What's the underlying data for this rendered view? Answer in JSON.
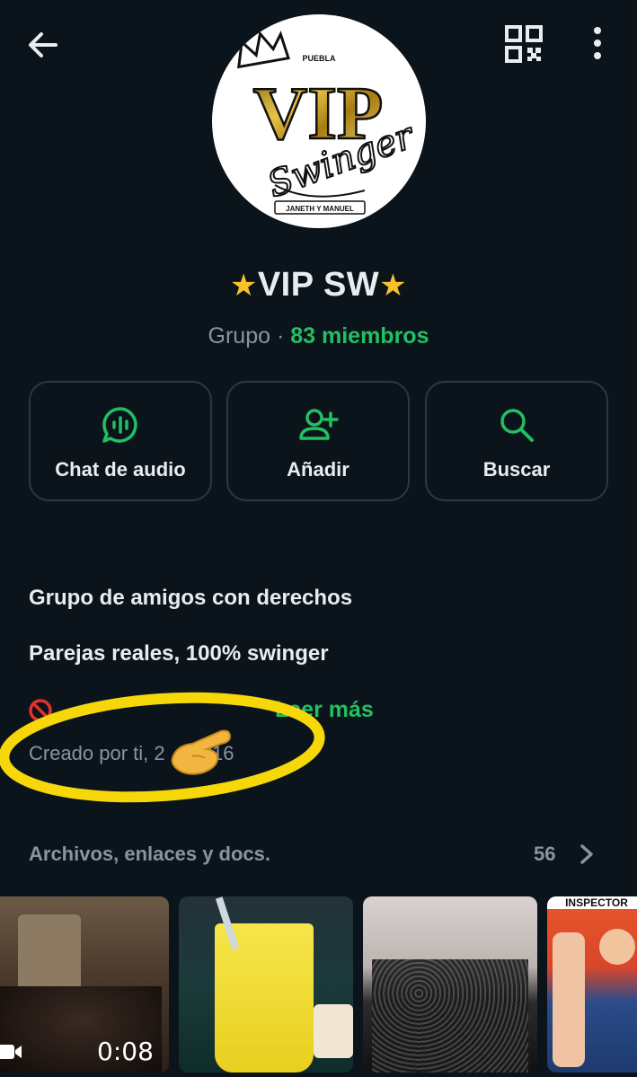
{
  "header": {
    "back_icon": "arrow-left-icon",
    "qr_icon": "qr-code-icon",
    "more_icon": "more-vertical-icon"
  },
  "avatar": {
    "top_text": "PUEBLA",
    "main_text": "VIP",
    "script_text": "Swinger",
    "bottom_text": "JANETH Y MANUEL"
  },
  "group": {
    "name": "VIP SW",
    "type_label": "Grupo",
    "separator": "·",
    "members_label": "83 miembros"
  },
  "actions": [
    {
      "label": "Chat de audio",
      "icon": "audio-chat-icon"
    },
    {
      "label": "Añadir",
      "icon": "add-person-icon"
    },
    {
      "label": "Buscar",
      "icon": "search-icon"
    }
  ],
  "description": {
    "line1": "Grupo de amigos con derechos",
    "line2": "Parejas reales, 100% swinger",
    "read_more": "Leer más",
    "created_by": "Creado por ti, 2",
    "created_suffix": "2/16"
  },
  "files": {
    "title": "Archivos, enlaces y docs.",
    "count": "56",
    "video_duration": "0:08",
    "thumb4_text": "INSPECTOR"
  },
  "colors": {
    "background": "#0b141a",
    "accent_green": "#21c063",
    "muted_text": "#8696a0",
    "card_border": "#2a3942",
    "highlight_yellow": "#f5d70a"
  }
}
